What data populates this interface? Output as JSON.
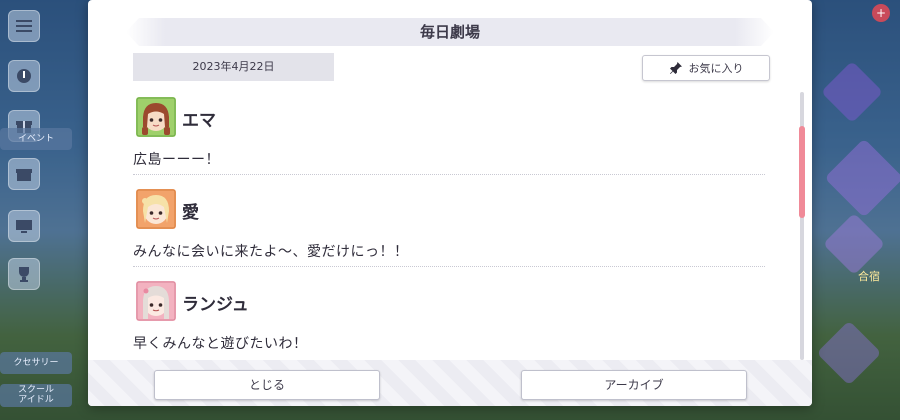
{
  "background": {
    "left_labels": [
      "イベント",
      "クセサリー",
      "スクール\nアイドル"
    ],
    "right_text": "合宿"
  },
  "modal": {
    "title": "毎日劇場",
    "date": "2023年4月22日",
    "favorite_label": "お気に入り",
    "entries": [
      {
        "speaker": "エマ",
        "text": "広島ーーー！",
        "avatar_color": "#9fd06b"
      },
      {
        "speaker": "愛",
        "text": "みんなに会いに来たよ〜、愛だけにっ！！",
        "avatar_color": "#f2a36b"
      },
      {
        "speaker": "ランジュ",
        "text": "早くみんなと遊びたいわ！",
        "avatar_color": "#f3b2c0"
      }
    ],
    "close_label": "とじる",
    "archive_label": "アーカイブ"
  },
  "colors": {
    "accent_scroll": "#f08a98",
    "panel_bg": "#ffffff",
    "title_bar": "#e9e9f1"
  },
  "icons": {
    "favorite": "pin-icon"
  }
}
